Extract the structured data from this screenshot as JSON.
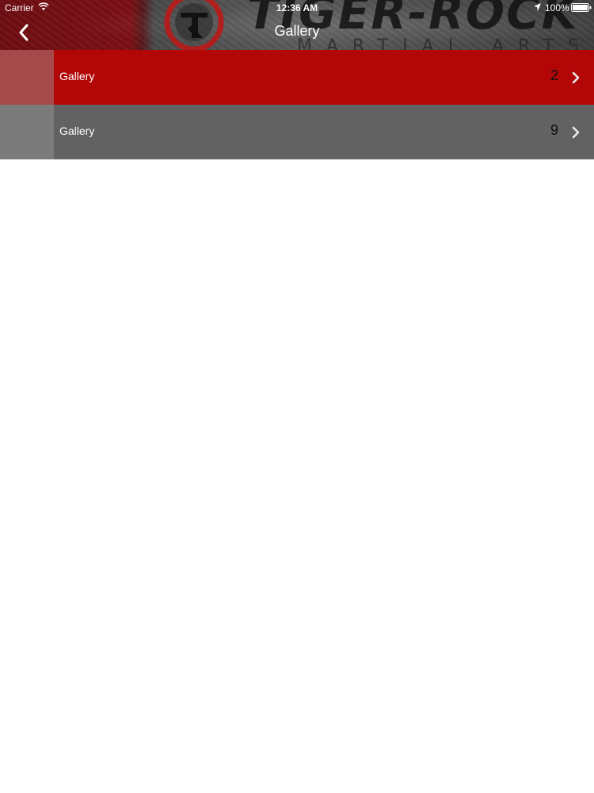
{
  "status_bar": {
    "carrier": "Carrier",
    "time": "12:36 AM",
    "battery": "100%"
  },
  "banner": {
    "title": "TIGER-ROCK",
    "subtitle": "MARTIAL ARTS"
  },
  "nav": {
    "title": "Gallery"
  },
  "rows": [
    {
      "label": "Gallery",
      "count": "2",
      "color": "#b30707"
    },
    {
      "label": "Gallery",
      "count": "9",
      "color": "#626262"
    }
  ],
  "icons": {
    "back": "chevron-left-icon",
    "row_arrow": "chevron-right-icon",
    "wifi": "wifi-icon",
    "location": "location-arrow-icon",
    "battery": "battery-icon"
  }
}
